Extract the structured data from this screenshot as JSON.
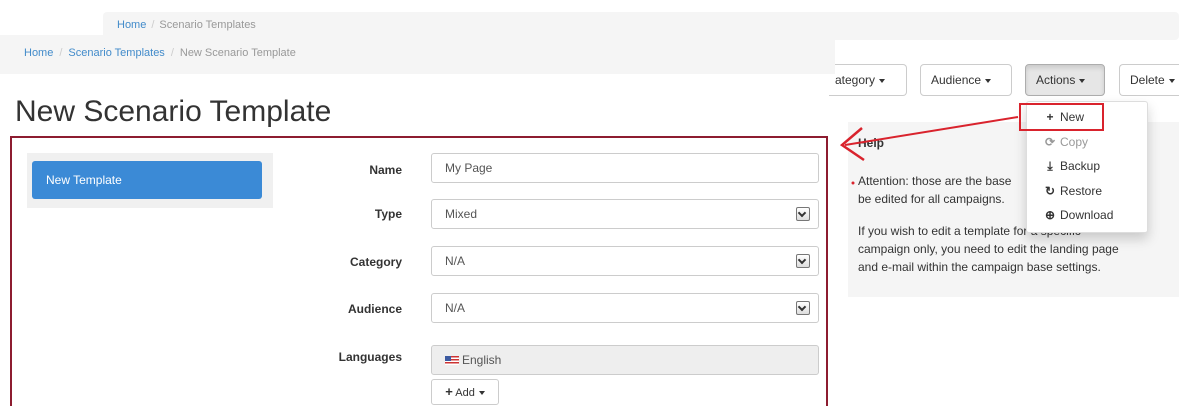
{
  "background": {
    "breadcrumb": [
      "Home",
      "Scenario Templates"
    ],
    "toolbar": {
      "category_label": "ategory",
      "audience_label": "Audience",
      "actions_label": "Actions",
      "delete_label": "Delete"
    },
    "actions_menu": [
      {
        "icon": "plus-icon",
        "glyph": "+",
        "label": "New",
        "disabled": false
      },
      {
        "icon": "copy-icon",
        "glyph": "⟳",
        "label": "Copy",
        "disabled": true
      },
      {
        "icon": "backup-icon",
        "glyph": "⤓",
        "label": "Backup",
        "disabled": false
      },
      {
        "icon": "restore-icon",
        "glyph": "↻",
        "label": "Restore",
        "disabled": false
      },
      {
        "icon": "download-icon",
        "glyph": "⊕",
        "label": "Download",
        "disabled": false
      }
    ],
    "help": {
      "title": "Help",
      "paragraph1_line1": "Attention: those are the base",
      "paragraph1_line2": "be edited for all campaigns.",
      "paragraph2_line1": "If you wish to edit a template for a specific",
      "paragraph2_line2": "campaign only, you need to edit the landing page",
      "paragraph2_line3": "and e-mail within the campaign base settings."
    }
  },
  "foreground": {
    "breadcrumb": {
      "home": "Home",
      "scenario_templates": "Scenario Templates",
      "current": "New Scenario Template"
    },
    "page_title": "New Scenario Template",
    "sidebar": {
      "new_template": "New Template"
    },
    "form": {
      "name": {
        "label": "Name",
        "value": "My Page"
      },
      "type": {
        "label": "Type",
        "value": "Mixed"
      },
      "category": {
        "label": "Category",
        "value": "N/A"
      },
      "audience": {
        "label": "Audience",
        "value": "N/A"
      },
      "languages": {
        "label": "Languages",
        "value": "English"
      },
      "add_label": "Add"
    }
  },
  "colors": {
    "annotation_red": "#d9232d",
    "form_border": "#8d1c30",
    "primary": "#3b8ad6",
    "link": "#428bca"
  }
}
